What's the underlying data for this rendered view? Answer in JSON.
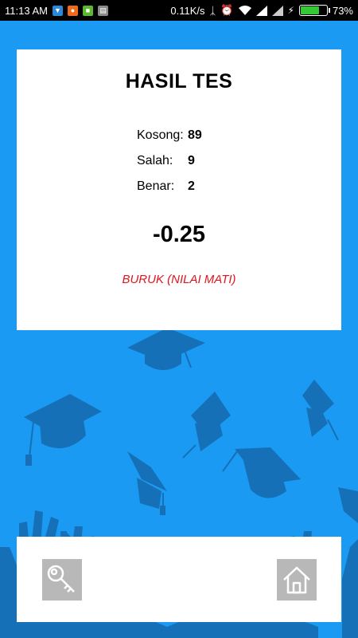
{
  "status_bar": {
    "time": "11:13 AM",
    "network_speed": "0.11K/s",
    "battery_percent": "73%",
    "battery_level": 0.73,
    "battery_color": "#34c934",
    "notification_icons": [
      "shield-notification-icon",
      "app-notification-icon",
      "android-notification-icon",
      "message-notification-icon"
    ]
  },
  "result": {
    "title": "HASIL TES",
    "stats": [
      {
        "label": "Kosong:",
        "value": "89"
      },
      {
        "label": "Salah:",
        "value": "9"
      },
      {
        "label": "Benar:",
        "value": "2"
      }
    ],
    "score": "-0.25",
    "verdict": "BURUK (NILAI MATI)",
    "verdict_color": "#e0141e"
  },
  "actions": {
    "key_icon": "key-icon",
    "home_icon": "home-icon"
  },
  "colors": {
    "background": "#1a9af2",
    "art": "#1670b8",
    "button": "#b8b8b8"
  }
}
